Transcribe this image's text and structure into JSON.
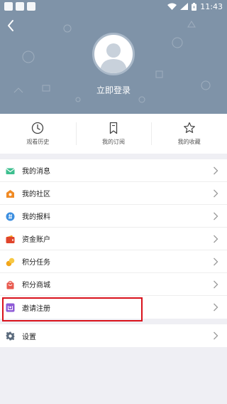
{
  "status_bar": {
    "time": "11:43"
  },
  "profile": {
    "login_label": "立即登录"
  },
  "quick_actions": [
    {
      "label": "观看历史",
      "icon": "clock-icon"
    },
    {
      "label": "我的订阅",
      "icon": "bookmark-icon"
    },
    {
      "label": "我的收藏",
      "icon": "star-icon"
    }
  ],
  "menu": [
    {
      "label": "我的消息",
      "icon": "envelope-icon",
      "color": "#3dbf8f"
    },
    {
      "label": "我的社区",
      "icon": "community-icon",
      "color": "#f08a24"
    },
    {
      "label": "我的报料",
      "icon": "report-icon",
      "color": "#3d8fe0"
    },
    {
      "label": "资金账户",
      "icon": "wallet-icon",
      "color": "#e0442b"
    },
    {
      "label": "积分任务",
      "icon": "points-task-icon",
      "color": "#f2a61b"
    },
    {
      "label": "积分商城",
      "icon": "shopping-bag-icon",
      "color": "#e85a4f"
    },
    {
      "label": "邀请注册",
      "icon": "invite-icon",
      "color": "#8e5bd6"
    }
  ],
  "settings": {
    "label": "设置",
    "icon": "gear-icon",
    "color": "#5b6b7d"
  },
  "highlight_color": "#d9121c"
}
